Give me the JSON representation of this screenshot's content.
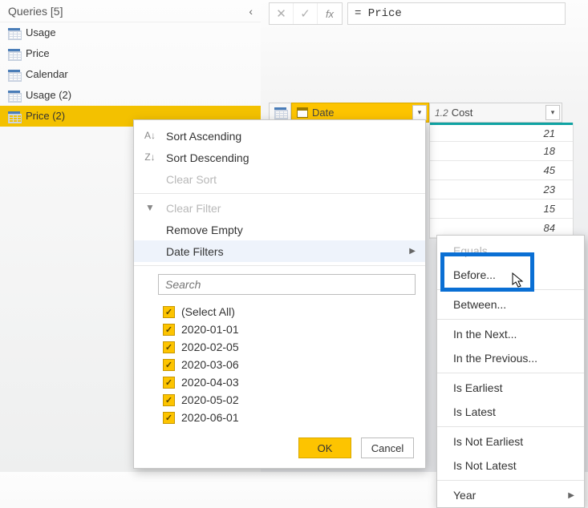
{
  "queries": {
    "header": "Queries [5]",
    "items": [
      "Usage",
      "Price",
      "Calendar",
      "Usage (2)",
      "Price (2)"
    ],
    "selected_index": 4
  },
  "formula_bar": {
    "cancel_glyph": "✕",
    "confirm_glyph": "✓",
    "fx_label": "fx",
    "expression": "= Price"
  },
  "columns": {
    "date": {
      "label": "Date",
      "type_prefix": ""
    },
    "cost": {
      "label": "Cost",
      "type_prefix": "1.2"
    }
  },
  "cost_values": [
    "21",
    "18",
    "45",
    "23",
    "15",
    "84"
  ],
  "filter_menu": {
    "sort_asc": "Sort Ascending",
    "sort_desc": "Sort Descending",
    "clear_sort": "Clear Sort",
    "clear_filter": "Clear Filter",
    "remove_empty": "Remove Empty",
    "date_filters": "Date Filters",
    "search_placeholder": "Search",
    "select_all": "(Select All)",
    "dates": [
      "2020-01-01",
      "2020-02-05",
      "2020-03-06",
      "2020-04-03",
      "2020-05-02",
      "2020-06-01"
    ],
    "ok": "OK",
    "cancel": "Cancel"
  },
  "date_submenu": {
    "equals": "Equals...",
    "before": "Before...",
    "between": "Between...",
    "in_next": "In the Next...",
    "in_previous": "In the Previous...",
    "is_earliest": "Is Earliest",
    "is_latest": "Is Latest",
    "is_not_earliest": "Is Not Earliest",
    "is_not_latest": "Is Not Latest",
    "year": "Year"
  }
}
